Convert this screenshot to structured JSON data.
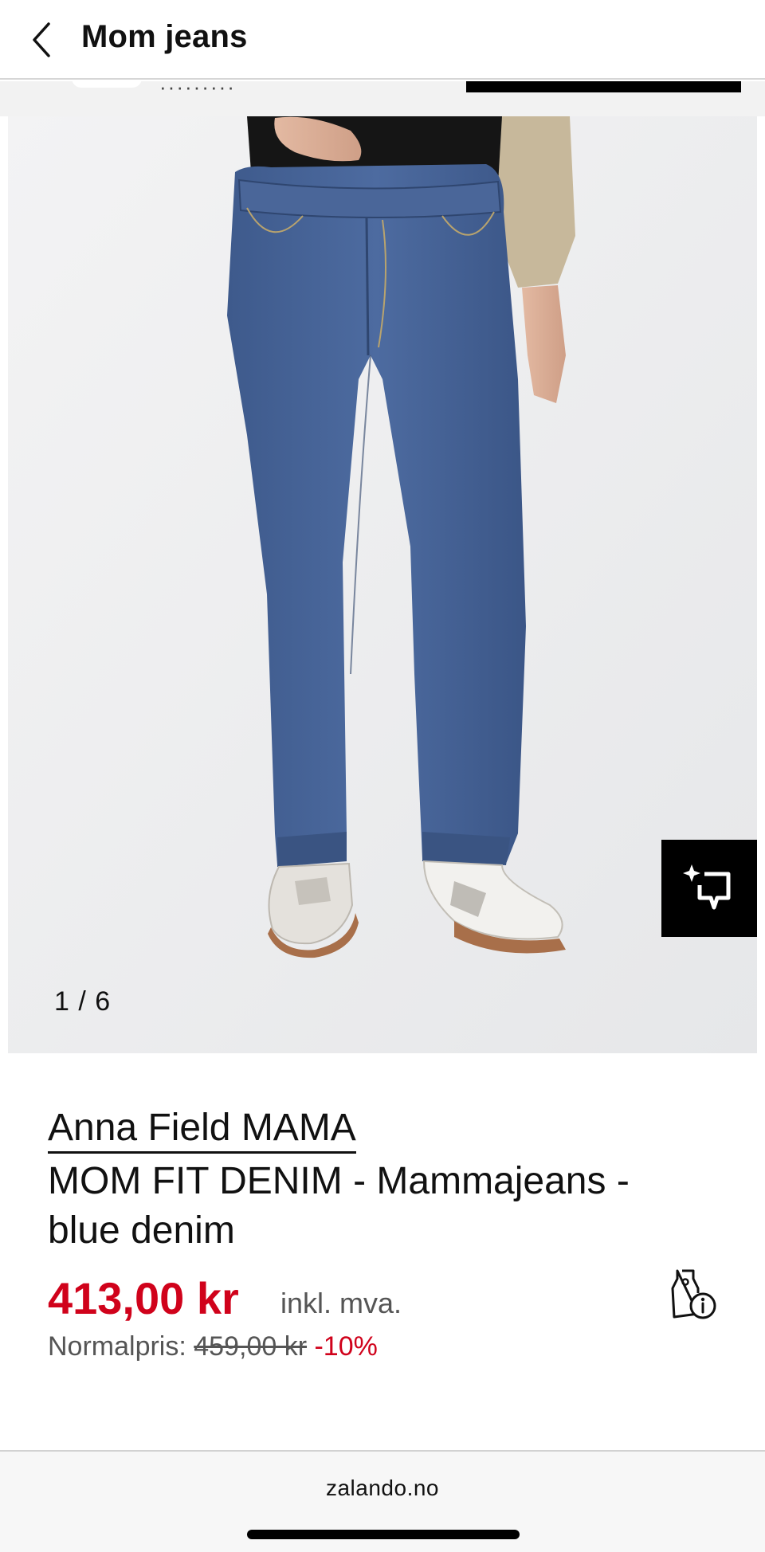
{
  "header": {
    "title": "Mom jeans"
  },
  "gallery": {
    "counter": "1 / 6"
  },
  "product": {
    "brand": "Anna Field MAMA",
    "name": "MOM FIT DENIM - Mammajeans - blue denim",
    "price": "413,00 kr",
    "vat_note": "inkl. mva.",
    "normal_price_label": "Normalpris:",
    "normal_price": "459,00 kr",
    "discount": "-10%"
  },
  "browser": {
    "domain": "zalando.no"
  },
  "colors": {
    "sale_red": "#d0021b",
    "text": "#111111",
    "muted": "#555555",
    "image_bg": "#eeeff0"
  },
  "icons": {
    "back": "chevron-left-icon",
    "ai_search": "sparkle-search-icon",
    "price_info": "price-tag-info-icon"
  }
}
